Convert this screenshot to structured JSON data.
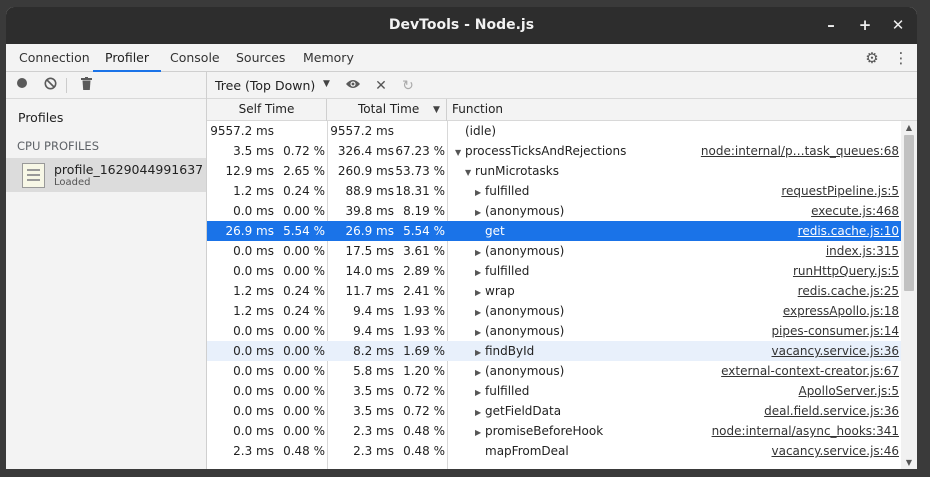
{
  "window": {
    "title": "DevTools - Node.js"
  },
  "window_controls": {
    "minimize": "–",
    "maximize": "+",
    "close": "✕"
  },
  "tabs": [
    {
      "label": "Connection"
    },
    {
      "label": "Profiler"
    },
    {
      "label": "Console"
    },
    {
      "label": "Sources"
    },
    {
      "label": "Memory"
    }
  ],
  "active_tab": "Profiler",
  "sidebar": {
    "title": "Profiles",
    "section": "CPU PROFILES",
    "profile": {
      "name": "profile_1629044991637",
      "status": "Loaded"
    }
  },
  "toolbar": {
    "view_mode": "Tree (Top Down)"
  },
  "table": {
    "headers": {
      "self": "Self Time",
      "total": "Total Time",
      "function": "Function"
    },
    "rows": [
      {
        "self": "9557.2 ms",
        "self_pct": "",
        "total": "9557.2 ms",
        "total_pct": "",
        "name": "(idle)",
        "url": "",
        "depth": 0,
        "arrow": ""
      },
      {
        "self": "3.5 ms",
        "self_pct": "0.72 %",
        "total": "326.4 ms",
        "total_pct": "67.23 %",
        "name": "processTicksAndRejections",
        "url": "node:internal/p…task_queues:68",
        "depth": 0,
        "arrow": "down"
      },
      {
        "self": "12.9 ms",
        "self_pct": "2.65 %",
        "total": "260.9 ms",
        "total_pct": "53.73 %",
        "name": "runMicrotasks",
        "url": "",
        "depth": 1,
        "arrow": "down"
      },
      {
        "self": "1.2 ms",
        "self_pct": "0.24 %",
        "total": "88.9 ms",
        "total_pct": "18.31 %",
        "name": "fulfilled",
        "url": "requestPipeline.js:5",
        "depth": 2,
        "arrow": "right"
      },
      {
        "self": "0.0 ms",
        "self_pct": "0.00 %",
        "total": "39.8 ms",
        "total_pct": "8.19 %",
        "name": "(anonymous)",
        "url": "execute.js:468",
        "depth": 2,
        "arrow": "right"
      },
      {
        "self": "26.9 ms",
        "self_pct": "5.54 %",
        "total": "26.9 ms",
        "total_pct": "5.54 %",
        "name": "get",
        "url": "redis.cache.js:10",
        "depth": 2,
        "arrow": "",
        "selected": true
      },
      {
        "self": "0.0 ms",
        "self_pct": "0.00 %",
        "total": "17.5 ms",
        "total_pct": "3.61 %",
        "name": "(anonymous)",
        "url": "index.js:315",
        "depth": 2,
        "arrow": "right"
      },
      {
        "self": "0.0 ms",
        "self_pct": "0.00 %",
        "total": "14.0 ms",
        "total_pct": "2.89 %",
        "name": "fulfilled",
        "url": "runHttpQuery.js:5",
        "depth": 2,
        "arrow": "right"
      },
      {
        "self": "1.2 ms",
        "self_pct": "0.24 %",
        "total": "11.7 ms",
        "total_pct": "2.41 %",
        "name": "wrap",
        "url": "redis.cache.js:25",
        "depth": 2,
        "arrow": "right"
      },
      {
        "self": "1.2 ms",
        "self_pct": "0.24 %",
        "total": "9.4 ms",
        "total_pct": "1.93 %",
        "name": "(anonymous)",
        "url": "expressApollo.js:18",
        "depth": 2,
        "arrow": "right"
      },
      {
        "self": "0.0 ms",
        "self_pct": "0.00 %",
        "total": "9.4 ms",
        "total_pct": "1.93 %",
        "name": "(anonymous)",
        "url": "pipes-consumer.js:14",
        "depth": 2,
        "arrow": "right"
      },
      {
        "self": "0.0 ms",
        "self_pct": "0.00 %",
        "total": "8.2 ms",
        "total_pct": "1.69 %",
        "name": "findById",
        "url": "vacancy.service.js:36",
        "depth": 2,
        "arrow": "right",
        "hover": true
      },
      {
        "self": "0.0 ms",
        "self_pct": "0.00 %",
        "total": "5.8 ms",
        "total_pct": "1.20 %",
        "name": "(anonymous)",
        "url": "external-context-creator.js:67",
        "depth": 2,
        "arrow": "right"
      },
      {
        "self": "0.0 ms",
        "self_pct": "0.00 %",
        "total": "3.5 ms",
        "total_pct": "0.72 %",
        "name": "fulfilled",
        "url": "ApolloServer.js:5",
        "depth": 2,
        "arrow": "right"
      },
      {
        "self": "0.0 ms",
        "self_pct": "0.00 %",
        "total": "3.5 ms",
        "total_pct": "0.72 %",
        "name": "getFieldData",
        "url": "deal.field.service.js:36",
        "depth": 2,
        "arrow": "right"
      },
      {
        "self": "0.0 ms",
        "self_pct": "0.00 %",
        "total": "2.3 ms",
        "total_pct": "0.48 %",
        "name": "promiseBeforeHook",
        "url": "node:internal/async_hooks:341",
        "depth": 2,
        "arrow": "right"
      },
      {
        "self": "2.3 ms",
        "self_pct": "0.48 %",
        "total": "2.3 ms",
        "total_pct": "0.48 %",
        "name": "mapFromDeal",
        "url": "vacancy.service.js:46",
        "depth": 2,
        "arrow": ""
      }
    ]
  },
  "colors": {
    "accent": "#1a73e8",
    "titlebar": "#2d2d2d",
    "selected_row": "#1a73e8"
  }
}
